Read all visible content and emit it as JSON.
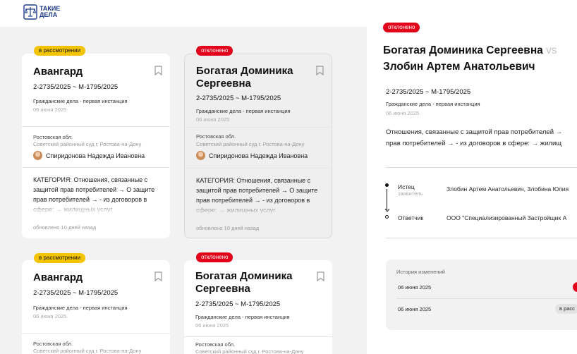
{
  "logo": {
    "line1": "ТАКИЕ",
    "line2": "ДЕЛА"
  },
  "cards": [
    {
      "status": "в рассмотрении",
      "title": "Авангард",
      "case_number": "2-2735/2025  ~ М-1795/2025",
      "case_type": "Гражданские дела - первая инстанция",
      "date": "06 июня 2025",
      "region": "Ростовская обл.",
      "court": "Советский районный суд г. Ростова-на-Дону",
      "judge": "Спиридонова Надежда Ивановна",
      "category": "КАТЕГОРИЯ: Отношения, связанные с защитой прав потребителей → О защите прав потребителей → - из договоров в сфере: → жилищных услуг",
      "updated": "обновлено 10 дней назад"
    },
    {
      "status": "отклонено",
      "title": "Богатая Доминика Сергеевна",
      "case_number": "2-2735/2025  ~ М-1795/2025",
      "case_type": "Гражданские дела - первая инстанция",
      "date": "06 июня 2025",
      "region": "Ростовская обл.",
      "court": "Советский районный суд г. Ростова-на-Дону",
      "judge": "Спиридонова Надежда Ивановна",
      "category": "КАТЕГОРИЯ: Отношения, связанные с защитой прав потребителей → О защите прав потребителей → - из договоров в сфере: → жилищных услуг",
      "updated": "обновлено 10 дней назад"
    },
    {
      "status": "в рассмотрении",
      "title": "Авангард",
      "case_number": "2-2735/2025  ~ М-1795/2025",
      "case_type": "Гражданские дела - первая инстанция",
      "date": "06 июня 2025",
      "region": "Ростовская обл.",
      "court": "Советский районный суд г. Ростова-на-Дону"
    },
    {
      "status": "отклонено",
      "title": "Богатая Доминика Сергеевна",
      "case_number": "2-2735/2025  ~ М-1795/2025",
      "case_type": "Гражданские дела - первая инстанция",
      "date": "06 июня 2025",
      "region": "Ростовская обл.",
      "court": "Советский районный суд г. Ростова-на-Дону"
    }
  ],
  "detail": {
    "status": "отклонено",
    "title_part1": "Богатая Доминика Сергеевна",
    "vs": "vs",
    "title_part2": "Злобин Артем Анатольевич",
    "case_number": "2-2735/2025  ~ М-1795/2025",
    "case_type": "Гражданские дела - первая инстанция",
    "date": "06 июня 2025",
    "category_line1": "Отношения, связанные с защитой прав потребителей →",
    "category_line2": "прав потребителей → - из договоров в сфере: → жилищ",
    "plaintiff_label": "Истец",
    "plaintiff_sub": "заявитель",
    "plaintiff_value": "Злобин Артем Анатольевич, Злобина Юлия",
    "defendant_label": "Ответчик",
    "defendant_value": "ООО \"Специализированный Застройщик А",
    "history_title": "История изменений",
    "history": [
      {
        "date": "06 июня 2025"
      },
      {
        "date": "06 июня 2025",
        "status": "в расс"
      }
    ]
  },
  "colors": {
    "review": "#f5c400",
    "reject": "#e3001b",
    "brand": "#1f3f8a"
  }
}
